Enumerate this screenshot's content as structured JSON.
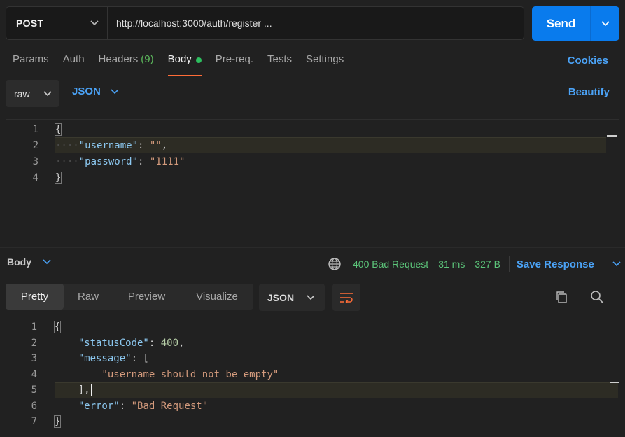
{
  "request": {
    "method": "POST",
    "url": "http://localhost:3000/auth/register ...",
    "send_label": "Send"
  },
  "req_tabs": [
    {
      "label": "Params"
    },
    {
      "label": "Auth"
    },
    {
      "label": "Headers",
      "count": "(9)"
    },
    {
      "label": "Body",
      "active": true
    },
    {
      "label": "Pre-req."
    },
    {
      "label": "Tests"
    },
    {
      "label": "Settings"
    }
  ],
  "cookies_label": "Cookies",
  "body_mode": "raw",
  "body_lang": "JSON",
  "beautify_label": "Beautify",
  "request_body": {
    "line_numbers": [
      "1",
      "2",
      "3",
      "4"
    ],
    "l1": "{",
    "l2_key": "\"username\"",
    "l2_colon": ": ",
    "l2_val": "\"\"",
    "l2_comma": ",",
    "l3_key": "\"password\"",
    "l3_colon": ": ",
    "l3_val": "\"1111\"",
    "l4": "}"
  },
  "response": {
    "body_label": "Body",
    "status": "400 Bad Request",
    "time": "31 ms",
    "size": "327 B",
    "save_label": "Save Response",
    "view_tabs": [
      "Pretty",
      "Raw",
      "Preview",
      "Visualize"
    ],
    "format": "JSON",
    "line_numbers": [
      "1",
      "2",
      "3",
      "4",
      "5",
      "6",
      "7"
    ],
    "l1": "{",
    "l2_key": "\"statusCode\"",
    "l2_colon": ": ",
    "l2_val": "400",
    "l2_comma": ",",
    "l3_key": "\"message\"",
    "l3_rest": ": [",
    "l4_val": "\"username should not be empty\"",
    "l5": "],",
    "l6_key": "\"error\"",
    "l6_colon": ": ",
    "l6_val": "\"Bad Request\"",
    "l7": "}"
  },
  "colors": {
    "accent": "#097bed",
    "link": "#4ba3f7",
    "active_tab_underline": "#ff6c37",
    "status_ok_text": "#5cc57a"
  }
}
